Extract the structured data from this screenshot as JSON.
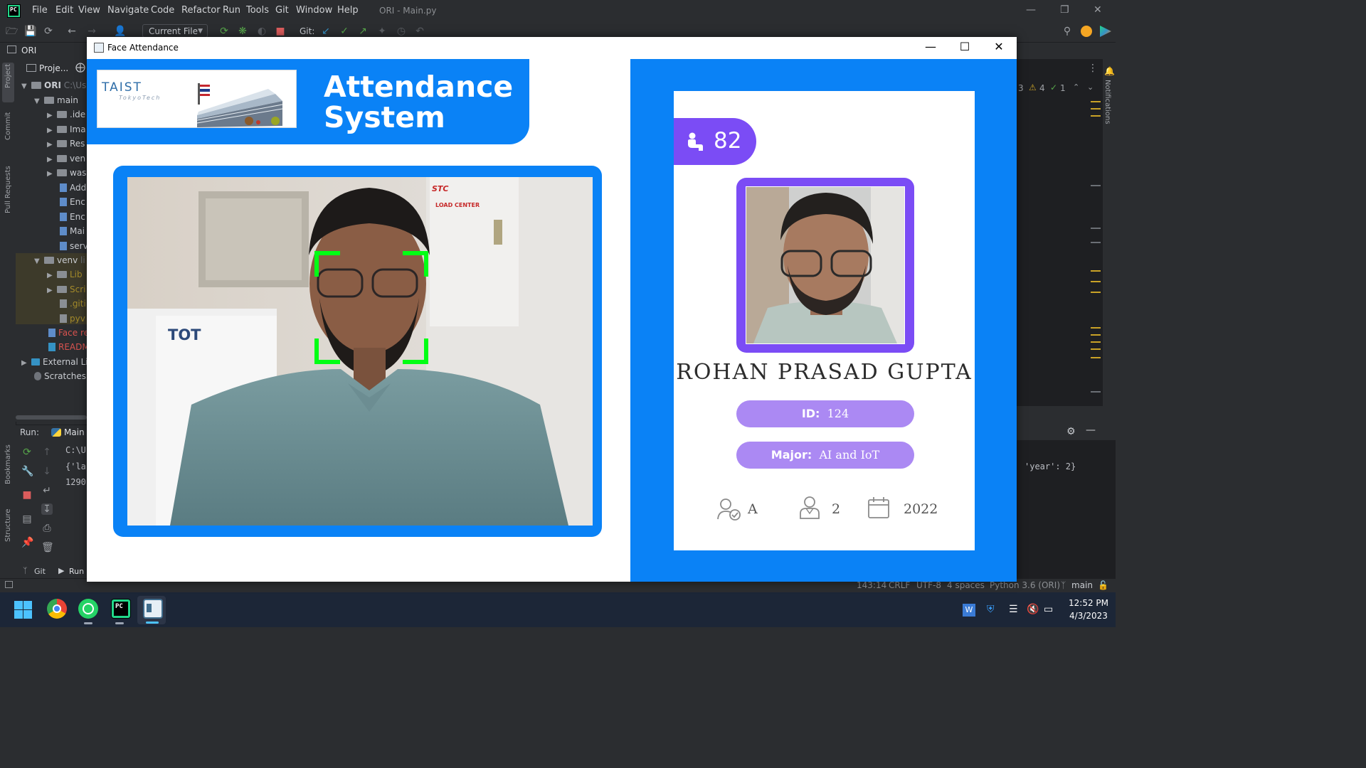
{
  "ide": {
    "menu": [
      "File",
      "Edit",
      "View",
      "Navigate",
      "Code",
      "Refactor",
      "Run",
      "Tools",
      "Git",
      "Window",
      "Help"
    ],
    "title": "ORI - Main.py",
    "run_config": "Current File",
    "git_label": "Git:",
    "project_breadcrumb": "ORI",
    "project_tab": "Proje...",
    "tree": [
      {
        "label": "ORI",
        "extra": "C:\\Us",
        "level": 0
      },
      {
        "label": "main",
        "level": 1
      },
      {
        "label": ".ide",
        "level": 2
      },
      {
        "label": "Ima",
        "level": 2
      },
      {
        "label": "Res",
        "level": 2
      },
      {
        "label": "ven",
        "level": 2
      },
      {
        "label": "was",
        "level": 2
      },
      {
        "label": "Add",
        "level": 3
      },
      {
        "label": "Enc",
        "level": 3
      },
      {
        "label": "Enc",
        "level": 3
      },
      {
        "label": "Mai",
        "level": 3
      },
      {
        "label": "serv",
        "level": 3
      },
      {
        "label": "venv",
        "extra": "li",
        "level": 1
      },
      {
        "label": "Lib",
        "level": 2
      },
      {
        "label": "Scri",
        "level": 2
      },
      {
        "label": ".giti",
        "level": 3
      },
      {
        "label": "pyv",
        "level": 3
      },
      {
        "label": "Face re",
        "level": 2
      },
      {
        "label": "READM",
        "level": 2
      },
      {
        "label": "External Li",
        "level": 0
      },
      {
        "label": "Scratches a",
        "level": 0
      }
    ],
    "left_stripe": [
      "Project",
      "Commit",
      "Pull Requests",
      "Bookmarks",
      "Structure"
    ],
    "run_label": "Run:",
    "run_tab": "Main",
    "console": [
      "C:\\U",
      "{'la",
      "1290"
    ],
    "console_right": "'year': 2}",
    "bottom_tabs": [
      "Git",
      "Run"
    ],
    "problems": {
      "warnings": "4",
      "checks": "1",
      "errors": "3"
    },
    "notifications": "Notifications",
    "status": {
      "position": "143:14",
      "line_sep": "CRLF",
      "encoding": "UTF-8",
      "indent": "4 spaces",
      "interpreter": "Python 3.6 (ORI)",
      "branch": "main"
    }
  },
  "taskbar": {
    "time": "12:52 PM",
    "date": "4/3/2023"
  },
  "app": {
    "window_title": "Face Attendance",
    "banner_title_line1": "Attendance",
    "banner_title_line2": "System",
    "logo_text": "TAIST",
    "logo_sub": "TokyoTech",
    "cam_labels": {
      "brand": "STC",
      "panel": "LOAD CENTER",
      "sign": "TOT"
    },
    "student": {
      "total_attendance": "82",
      "name": "ROHAN PRASAD GUPTA",
      "id_label": "ID:",
      "id_value": "124",
      "major_label": "Major:",
      "major_value": "AI and IoT",
      "standing": "A",
      "year": "2",
      "starting_year": "2022"
    },
    "colors": {
      "accent_blue": "#0a82f6",
      "accent_purple": "#7b4cf5",
      "pill_purple": "#ab89f3",
      "face_box": "#00ff14"
    }
  }
}
